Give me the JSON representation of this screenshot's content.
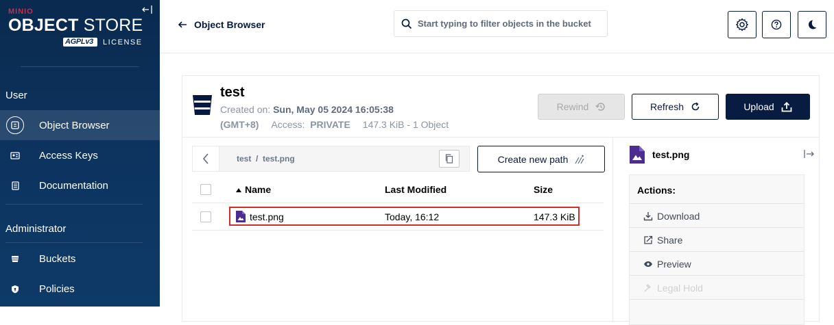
{
  "sidebar": {
    "logo": {
      "brand": "MINIO",
      "product_bold": "OBJECT",
      "product_light": "STORE",
      "agpl": "AGPLv3",
      "license": "LICENSE"
    },
    "sections": [
      {
        "label": "User"
      },
      {
        "label": "Administrator"
      }
    ],
    "items": [
      {
        "label": "Object Browser",
        "icon": "object-browser-icon",
        "active": true
      },
      {
        "label": "Access Keys",
        "icon": "access-keys-icon"
      },
      {
        "label": "Documentation",
        "icon": "documentation-icon"
      },
      {
        "label": "Buckets",
        "icon": "buckets-icon"
      },
      {
        "label": "Policies",
        "icon": "policies-icon"
      }
    ]
  },
  "topbar": {
    "back_label": "Object Browser",
    "search_placeholder": "Start typing to filter objects in the bucket",
    "buttons": [
      "settings-icon",
      "help-icon",
      "dark-mode-icon"
    ]
  },
  "bucket": {
    "name": "test",
    "created_label": "Created on:",
    "created_value": "Sun, May 05 2024 16:05:38",
    "timezone": "(GMT+8)",
    "access_label": "Access:",
    "access_value": "PRIVATE",
    "summary": "147.3 KiB - 1 Object"
  },
  "toolbar": {
    "rewind_label": "Rewind",
    "refresh_label": "Refresh",
    "upload_label": "Upload"
  },
  "path": {
    "breadcrumb": "test  /  test.png",
    "create_path_label": "Create new path"
  },
  "table": {
    "columns": [
      "Name",
      "Last Modified",
      "Size"
    ],
    "sort_column": "Name",
    "sort_direction": "ascending",
    "rows": [
      {
        "name": "test.png",
        "modified": "Today, 16:12",
        "size": "147.3 KiB",
        "selected": false
      }
    ]
  },
  "details": {
    "file_name": "test.png",
    "actions_title": "Actions:",
    "actions": [
      {
        "label": "Download",
        "icon": "download-icon",
        "enabled": true
      },
      {
        "label": "Share",
        "icon": "share-icon",
        "enabled": true
      },
      {
        "label": "Preview",
        "icon": "eye-icon",
        "enabled": true
      },
      {
        "label": "Legal Hold",
        "icon": "legal-hold-icon",
        "enabled": false
      }
    ]
  },
  "colors": {
    "sidebar_bg": "#0a2a4f",
    "primary": "#081c42",
    "brand_red": "#c72c48",
    "file_icon": "#4b2c8f",
    "highlight": "#d42a2a"
  }
}
